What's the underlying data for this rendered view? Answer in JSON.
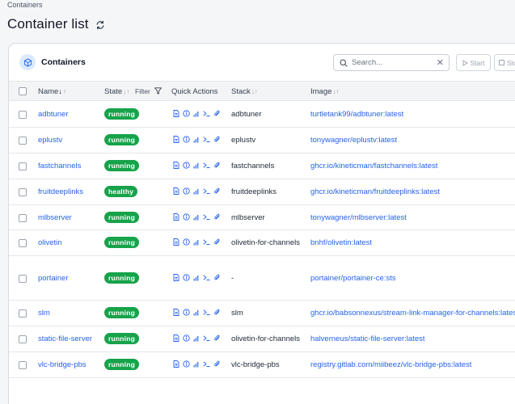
{
  "breadcrumb": "Containers",
  "page_title": "Container list",
  "card": {
    "title": "Containers",
    "search_placeholder": "Search...",
    "start_label": "Start",
    "stop_label": "Sto"
  },
  "columns": {
    "name": "Name",
    "state": "State",
    "filter": "Filter",
    "quick_actions": "Quick Actions",
    "stack": "Stack",
    "image": "Image"
  },
  "rows": [
    {
      "name": "adbtuner",
      "state": "running",
      "stack": "adbtuner",
      "image": "turtletank99/adbtuner:latest"
    },
    {
      "name": "eplustv",
      "state": "running",
      "stack": "eplustv",
      "image": "tonywagner/eplustv:latest"
    },
    {
      "name": "fastchannels",
      "state": "running",
      "stack": "fastchannels",
      "image": "ghcr.io/kineticman/fastchannels:latest"
    },
    {
      "name": "fruitdeeplinks",
      "state": "healthy",
      "stack": "fruitdeeplinks",
      "image": "ghcr.io/kineticman/fruitdeeplinks:latest"
    },
    {
      "name": "mlbserver",
      "state": "running",
      "stack": "mlbserver",
      "image": "tonywagner/mlbserver:latest"
    },
    {
      "name": "olivetin",
      "state": "running",
      "stack": "olivetin-for-channels",
      "image": "bnhf/olivetin:latest"
    },
    {
      "name": "portainer",
      "state": "running",
      "stack": "-",
      "image": "portainer/portainer-ce:sts"
    },
    {
      "name": "slm",
      "state": "running",
      "stack": "slm",
      "image": "ghcr.io/babsonnexus/stream-link-manager-for-channels:latest"
    },
    {
      "name": "static-file-server",
      "state": "running",
      "stack": "olivetin-for-channels",
      "image": "halverneus/static-file-server:latest"
    },
    {
      "name": "vlc-bridge-pbs",
      "state": "running",
      "stack": "vlc-bridge-pbs",
      "image": "registry.gitlab.com/miibeez/vlc-bridge-pbs:latest"
    }
  ],
  "colors": {
    "accent": "#2563eb",
    "badge": "#16a34a"
  }
}
